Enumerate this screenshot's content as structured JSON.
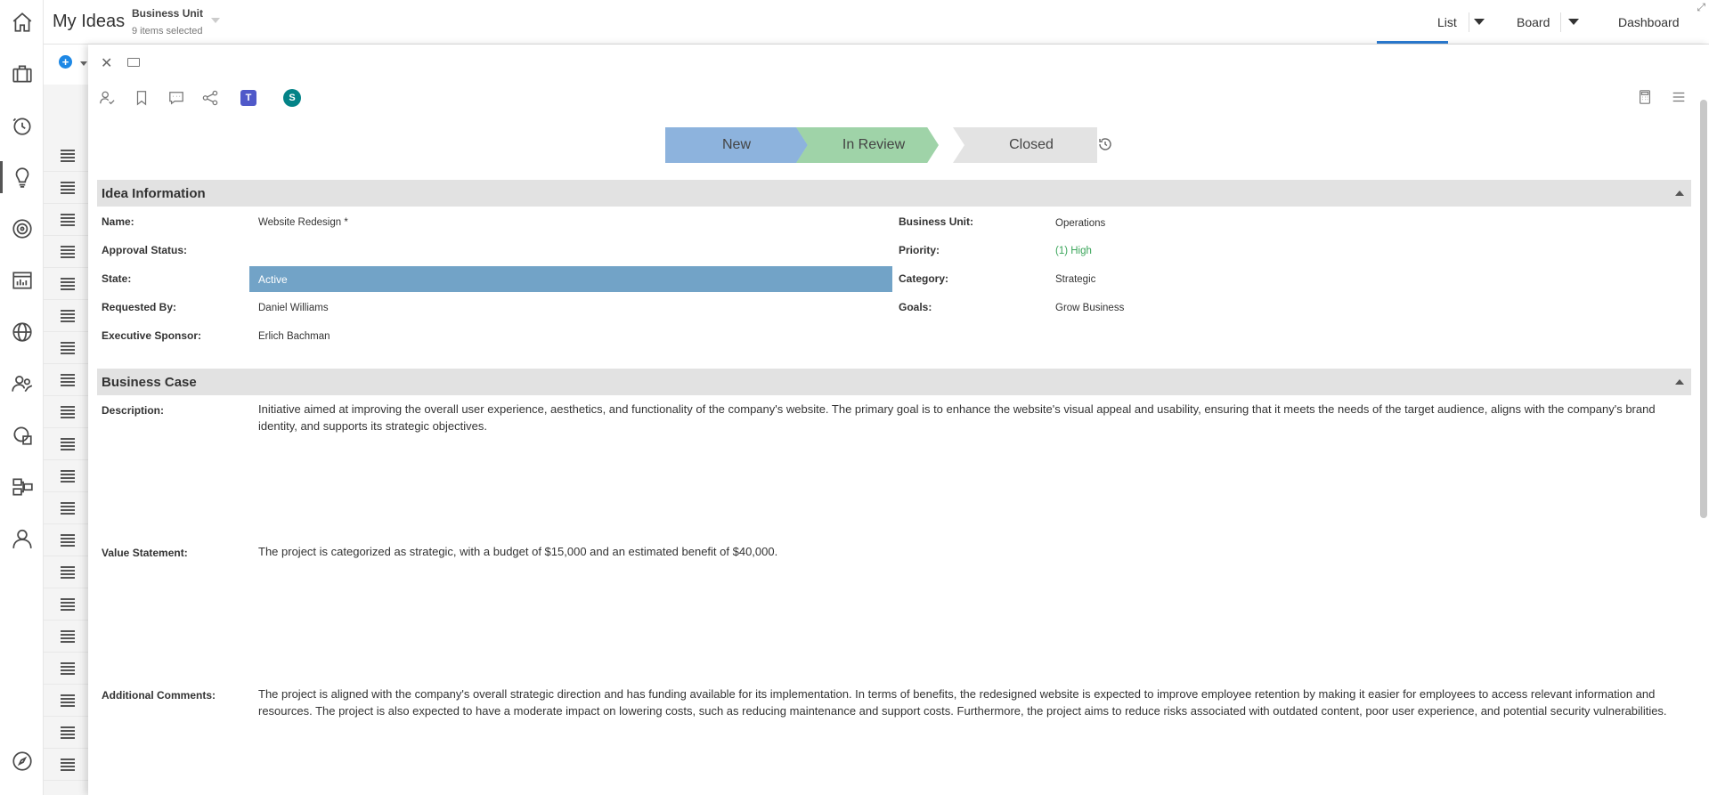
{
  "header": {
    "app_title": "My Ideas",
    "business_unit_label": "Business Unit",
    "business_unit_selection": "9 items selected",
    "views": [
      {
        "label": "List"
      },
      {
        "label": "Board"
      },
      {
        "label": "Dashboard"
      }
    ],
    "active_view": "List"
  },
  "nav": {
    "items": [
      {
        "name": "home",
        "icon": "home-icon"
      },
      {
        "name": "portfolios",
        "icon": "briefcase-icon"
      },
      {
        "name": "timesheets",
        "icon": "clock-icon"
      },
      {
        "name": "ideas",
        "icon": "lightbulb-icon",
        "active": true
      },
      {
        "name": "goals",
        "icon": "target-icon"
      },
      {
        "name": "reports",
        "icon": "report-icon"
      },
      {
        "name": "global",
        "icon": "globe-icon"
      },
      {
        "name": "resources",
        "icon": "people-icon"
      },
      {
        "name": "programs",
        "icon": "program-icon"
      },
      {
        "name": "workflow",
        "icon": "workflow-icon"
      },
      {
        "name": "profile",
        "icon": "user-icon"
      },
      {
        "name": "navigator",
        "icon": "compass-icon"
      }
    ]
  },
  "workflow": {
    "stages": [
      {
        "label": "New",
        "color": "#8db3dd"
      },
      {
        "label": "In Review",
        "color": "#9fd3a8"
      },
      {
        "label": "Closed",
        "color": "#e3e3e3"
      }
    ]
  },
  "idea_information": {
    "title": "Idea Information",
    "fields_left": [
      {
        "label": "Name:",
        "value": "Website Redesign *"
      },
      {
        "label": "Approval Status:",
        "value": ""
      },
      {
        "label": "State:",
        "value": "Active"
      },
      {
        "label": "Requested By:",
        "value": "Daniel Williams"
      },
      {
        "label": "Executive Sponsor:",
        "value": "Erlich Bachman"
      }
    ],
    "fields_right": [
      {
        "label": "Business Unit:",
        "value": "Operations"
      },
      {
        "label": "Priority:",
        "value": "(1) High"
      },
      {
        "label": "Category:",
        "value": "Strategic"
      },
      {
        "label": "Goals:",
        "value": "Grow Business"
      }
    ],
    "state_color": "#72a3c7",
    "priority_color": "#3aa55a"
  },
  "business_case": {
    "title": "Business Case",
    "description_label": "Description:",
    "description": "Initiative aimed at improving the overall user experience, aesthetics, and functionality of the company's website. The primary goal is to enhance the website's visual appeal and usability, ensuring that it meets the needs of the target audience, aligns with the company's brand identity, and supports its strategic objectives.",
    "value_statement_label": "Value Statement:",
    "value_statement": "The project is categorized as strategic, with a budget of $15,000 and an estimated benefit of $40,000.",
    "additional_comments_label": "Additional Comments:",
    "additional_comments": "The project is aligned with the company's overall strategic direction and has funding available for its implementation. In terms of benefits, the redesigned website is expected to improve employee retention by making it easier for employees to access relevant information and resources. The project is also expected to have a moderate impact on lowering costs, such as reducing maintenance and support costs. Furthermore, the project aims to reduce risks associated with outdated content, poor user experience, and potential security vulnerabilities."
  },
  "icons": {
    "teams_letter": "T",
    "sharepoint_letter": "S"
  },
  "panel_close_glyph": "✕"
}
